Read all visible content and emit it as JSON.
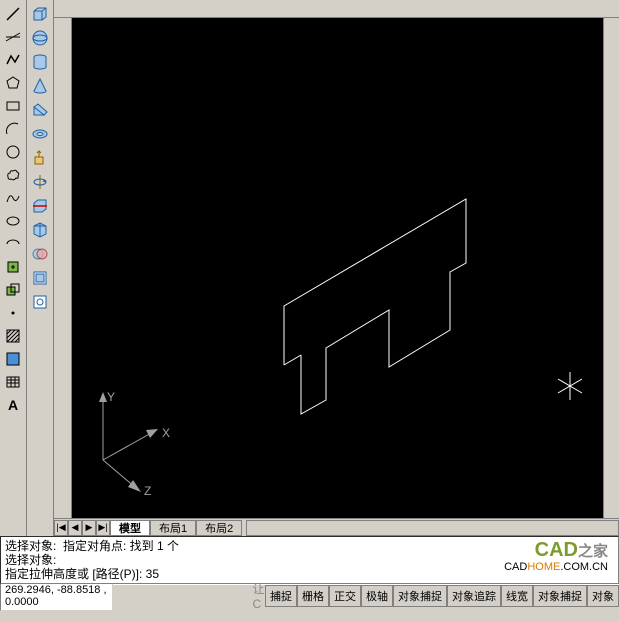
{
  "toolbar_draw": [
    {
      "name": "line-icon"
    },
    {
      "name": "xline-icon"
    },
    {
      "name": "polyline-icon"
    },
    {
      "name": "polygon-icon"
    },
    {
      "name": "rectangle-icon"
    },
    {
      "name": "arc-icon"
    },
    {
      "name": "circle-icon"
    },
    {
      "name": "revcloud-icon"
    },
    {
      "name": "spline-icon"
    },
    {
      "name": "ellipse-icon"
    },
    {
      "name": "ellipsearc-icon"
    },
    {
      "name": "insert-icon"
    },
    {
      "name": "block-icon"
    },
    {
      "name": "point-icon"
    },
    {
      "name": "hatch-icon"
    },
    {
      "name": "region-icon"
    },
    {
      "name": "table-icon"
    },
    {
      "name": "mtext-icon"
    }
  ],
  "toolbar_3d": [
    {
      "name": "box-icon"
    },
    {
      "name": "sphere-icon"
    },
    {
      "name": "cylinder-icon"
    },
    {
      "name": "cone-icon"
    },
    {
      "name": "wedge-icon"
    },
    {
      "name": "torus-icon"
    },
    {
      "name": "extrude-icon"
    },
    {
      "name": "revolve-icon"
    },
    {
      "name": "slice-icon"
    },
    {
      "name": "section-icon"
    },
    {
      "name": "interfere-icon"
    },
    {
      "name": "setup-icon"
    },
    {
      "name": "profile-icon"
    }
  ],
  "axes": {
    "x": "X",
    "y": "Y",
    "z": "Z"
  },
  "tabs": {
    "nav": [
      "|◀",
      "◀",
      "▶",
      "▶|"
    ],
    "items": [
      {
        "label": "模型",
        "active": true
      },
      {
        "label": "布局1",
        "active": false
      },
      {
        "label": "布局2",
        "active": false
      }
    ]
  },
  "command": {
    "line1": "选择对象:  指定对角点: 找到 1 个",
    "line2": "选择对象:",
    "line3": "指定拉伸高度或 [路径(P)]: 35"
  },
  "watermark": {
    "brand_bold": "CAD",
    "brand_rest": "之家",
    "url_pre": "CAD",
    "url_orange": "HOME",
    "url_post": ".COM.CN"
  },
  "status": {
    "coords": "269.2946, -88.8518 , 0.0000",
    "hint_prefix": "让C",
    "buttons": [
      "捕捉",
      "栅格",
      "正交",
      "极轴",
      "对象捕捉",
      "对象追踪",
      "线宽",
      "对象捕捉",
      "对象"
    ]
  }
}
